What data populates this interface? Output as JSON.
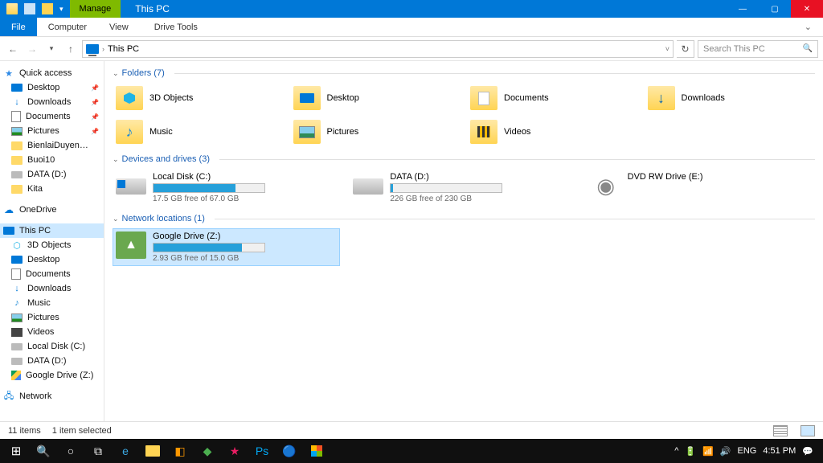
{
  "titlebar": {
    "manage": "Manage",
    "drivetools": "Drive Tools",
    "title": "This PC"
  },
  "ribbon": {
    "file": "File",
    "computer": "Computer",
    "view": "View",
    "drivetools": "Drive Tools"
  },
  "address": {
    "location": "This PC",
    "dropdown_indicator": "˅"
  },
  "search": {
    "placeholder": "Search This PC"
  },
  "sidebar": {
    "quick": "Quick access",
    "pins": [
      {
        "label": "Desktop"
      },
      {
        "label": "Downloads"
      },
      {
        "label": "Documents"
      },
      {
        "label": "Pictures"
      },
      {
        "label": "BienlaiDuyenDatHa"
      },
      {
        "label": "Buoi10"
      },
      {
        "label": "DATA (D:)"
      },
      {
        "label": "Kita"
      }
    ],
    "onedrive": "OneDrive",
    "thispc": "This PC",
    "pc_items": [
      {
        "label": "3D Objects"
      },
      {
        "label": "Desktop"
      },
      {
        "label": "Documents"
      },
      {
        "label": "Downloads"
      },
      {
        "label": "Music"
      },
      {
        "label": "Pictures"
      },
      {
        "label": "Videos"
      },
      {
        "label": "Local Disk (C:)"
      },
      {
        "label": "DATA (D:)"
      },
      {
        "label": "Google Drive (Z:)"
      }
    ],
    "network": "Network"
  },
  "sections": {
    "folders": {
      "title": "Folders (7)",
      "items": [
        "3D Objects",
        "Desktop",
        "Documents",
        "Downloads",
        "Music",
        "Pictures",
        "Videos"
      ]
    },
    "drives": {
      "title": "Devices and drives (3)",
      "items": [
        {
          "name": "Local Disk (C:)",
          "sub": "17.5 GB free of 67.0 GB",
          "pct": 74
        },
        {
          "name": "DATA (D:)",
          "sub": "226 GB free of 230 GB",
          "pct": 2
        },
        {
          "name": "DVD RW Drive (E:)",
          "sub": "",
          "pct": -1
        }
      ]
    },
    "network": {
      "title": "Network locations (1)",
      "items": [
        {
          "name": "Google Drive (Z:)",
          "sub": "2.93 GB free of 15.0 GB",
          "pct": 80
        }
      ]
    }
  },
  "statusbar": {
    "count": "11 items",
    "selected": "1 item selected"
  },
  "tray": {
    "lang": "ENG",
    "time": "4:51 PM"
  }
}
